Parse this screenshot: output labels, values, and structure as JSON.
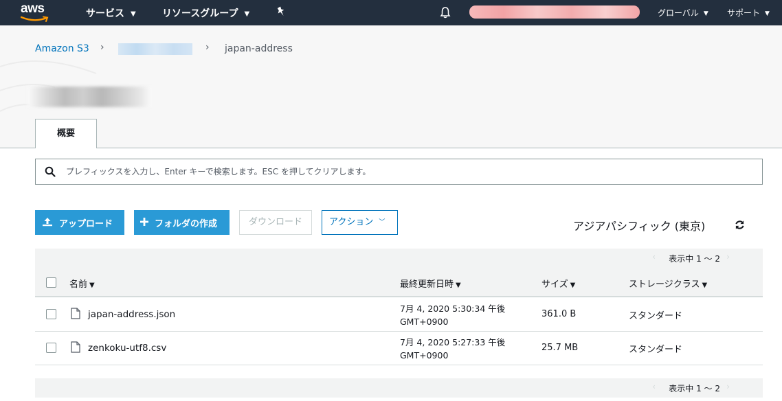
{
  "nav": {
    "logo": "aws",
    "services": "サービス",
    "resource_groups": "リソースグループ",
    "region_menu": "グローバル",
    "support": "サポート"
  },
  "breadcrumb": {
    "root": "Amazon S3",
    "current": "japan-address"
  },
  "tabs": [
    {
      "label": "概要"
    }
  ],
  "search": {
    "placeholder": "プレフィックスを入力し、Enter キーで検索します。ESC を押してクリアします。"
  },
  "toolbar": {
    "upload": "アップロード",
    "create_folder": "フォルダの作成",
    "download": "ダウンロード",
    "actions": "アクション",
    "region": "アジアパシフィック (東京)"
  },
  "pager": {
    "text": "表示中 1 〜 2"
  },
  "table": {
    "columns": {
      "name": "名前",
      "modified": "最終更新日時",
      "size": "サイズ",
      "storage_class": "ストレージクラス"
    },
    "rows": [
      {
        "name": "japan-address.json",
        "modified_line1": "7月 4, 2020 5:30:34 午後",
        "modified_line2": "GMT+0900",
        "size": "361.0 B",
        "storage_class": "スタンダード"
      },
      {
        "name": "zenkoku-utf8.csv",
        "modified_line1": "7月 4, 2020 5:27:33 午後",
        "modified_line2": "GMT+0900",
        "size": "25.7 MB",
        "storage_class": "スタンダード"
      }
    ]
  },
  "colors": {
    "nav_bg": "#232f3e",
    "primary_button": "#2a9ad6",
    "link": "#0073bb",
    "logo_smile": "#ff9900"
  }
}
